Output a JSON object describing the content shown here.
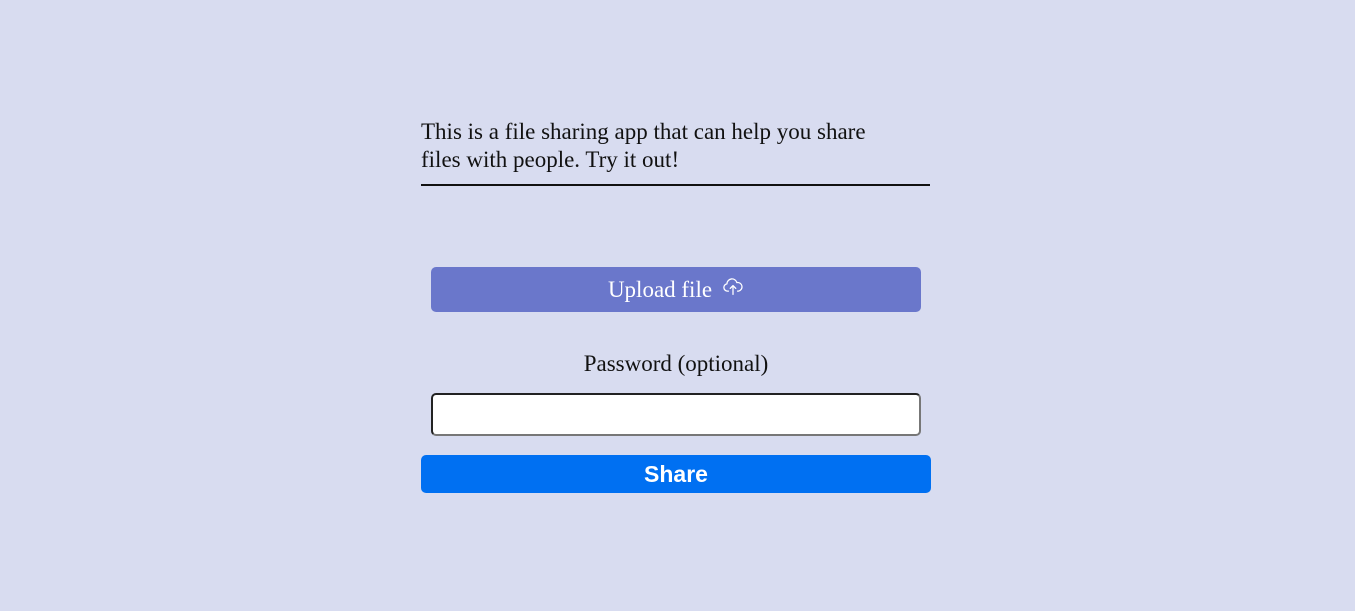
{
  "intro": {
    "text": "This is a file sharing app that can help you share files with people. Try it out!"
  },
  "upload": {
    "label": "Upload file",
    "icon": "cloud-upload-icon",
    "color": "#6a77cb"
  },
  "password": {
    "label": "Password (optional)",
    "value": "",
    "placeholder": ""
  },
  "share": {
    "label": "Share",
    "color": "#0070f2"
  },
  "theme": {
    "background": "#d8dcf0"
  }
}
